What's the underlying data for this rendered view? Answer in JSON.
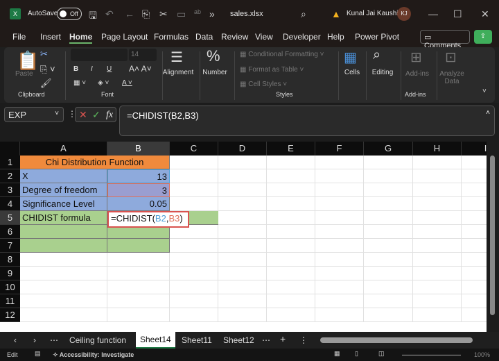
{
  "titlebar": {
    "autosave_label": "AutoSave",
    "autosave_state": "Off",
    "filename": "sales.xlsx",
    "user": "Kunal Jai Kaushik",
    "initials": "KJ",
    "more": "»"
  },
  "tabs": [
    "File",
    "Insert",
    "Home",
    "Page Layout",
    "Formulas",
    "Data",
    "Review",
    "View",
    "Developer",
    "Help",
    "Power Pivot"
  ],
  "active_tab": "Home",
  "comments_label": "Comments",
  "ribbon": {
    "paste": "Paste",
    "clipboard": "Clipboard",
    "font_size": "14",
    "font": "Font",
    "alignment": "Alignment",
    "number": "Number",
    "cond_format": "Conditional Formatting",
    "format_table": "Format as Table",
    "cell_styles": "Cell Styles",
    "styles": "Styles",
    "cells": "Cells",
    "editing": "Editing",
    "addins": "Add-ins",
    "addins_group": "Add-ins",
    "analyze": "Analyze",
    "analyze2": "Data",
    "bold": "B",
    "italic": "I",
    "underline": "U"
  },
  "formula_bar": {
    "name_box": "EXP",
    "formula": "=CHIDIST(B2,B3)",
    "fx": "fx"
  },
  "columns": [
    "A",
    "B",
    "C",
    "D",
    "E",
    "F",
    "G",
    "H",
    "I"
  ],
  "rows": [
    "1",
    "2",
    "3",
    "4",
    "5",
    "6",
    "7",
    "8",
    "9",
    "10",
    "11",
    "12"
  ],
  "cells": {
    "title": "Chi Distribution Function",
    "a2": "X",
    "b2": "13",
    "a3": "Degree of freedom",
    "b3": "3",
    "a4": "Significance Level",
    "b4": "0.05",
    "a5": "CHIDIST formula",
    "b5_prefix": "=CHIDIST(",
    "b5_ref1": "B2",
    "b5_comma": ",",
    "b5_ref2": "B3",
    "b5_suffix": ")"
  },
  "colors": {
    "orange": "#f08a3c",
    "blue": "#8eaadc",
    "green": "#a9d08e",
    "ref1": "#4e9fd8",
    "ref2": "#e0705a",
    "accent": "#1f9d55"
  },
  "sheets": [
    "Ceiling function",
    "Sheet14",
    "Sheet11",
    "Sheet12"
  ],
  "active_sheet": "Sheet14",
  "status": {
    "mode": "Edit",
    "accessibility": "Accessibility: Investigate",
    "zoom": "100%"
  }
}
